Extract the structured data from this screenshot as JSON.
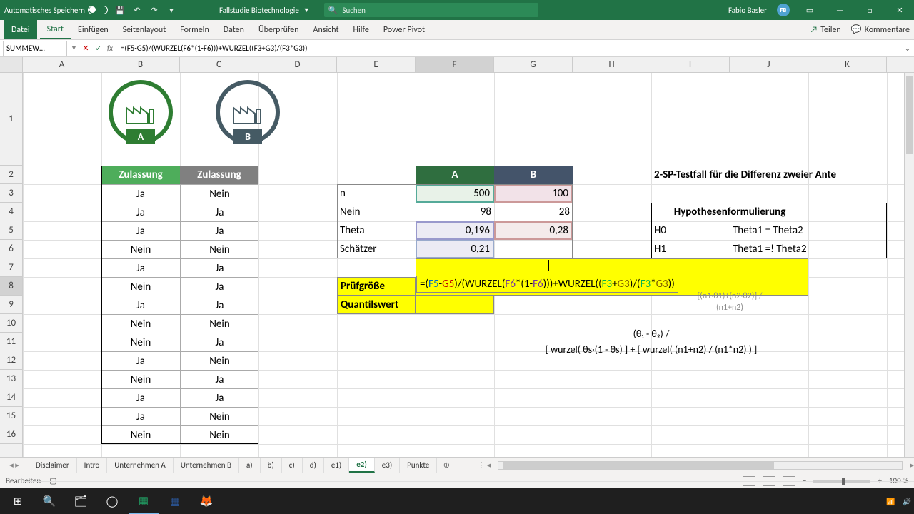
{
  "titlebar": {
    "autosave_label": "Automatisches Speichern",
    "doc_title": "Fallstudie Biotechnologie",
    "search_placeholder": "Suchen",
    "user_name": "Fabio Basler",
    "user_initials": "FB"
  },
  "ribbon": {
    "tabs": [
      "Datei",
      "Start",
      "Einfügen",
      "Seitenlayout",
      "Formeln",
      "Daten",
      "Überprüfen",
      "Ansicht",
      "Hilfe",
      "Power Pivot"
    ],
    "share": "Teilen",
    "comments": "Kommentare"
  },
  "formula_bar": {
    "namebox": "SUMMEW…",
    "formula": "=(F5-G5)/(WURZEL(F6*(1-F6)))+WURZEL((F3+G3)/(F3*G3))"
  },
  "columns": [
    "A",
    "B",
    "C",
    "D",
    "E",
    "F",
    "G",
    "H",
    "I",
    "J",
    "K"
  ],
  "rows": [
    "1",
    "2",
    "3",
    "4",
    "5",
    "6",
    "7",
    "8",
    "9",
    "10",
    "11",
    "12",
    "13",
    "14",
    "15",
    "16"
  ],
  "logo": {
    "a": "A",
    "b": "B"
  },
  "data": {
    "zul_header": "Zulassung",
    "col_b": [
      "Ja",
      "Ja",
      "Ja",
      "Nein",
      "Ja",
      "Nein",
      "Ja",
      "Nein",
      "Nein",
      "Ja",
      "Nein",
      "Ja",
      "Ja",
      "Nein"
    ],
    "col_c": [
      "Nein",
      "Ja",
      "Ja",
      "Nein",
      "Ja",
      "Ja",
      "Ja",
      "Nein",
      "Ja",
      "Nein",
      "Ja",
      "Ja",
      "Nein",
      "Nein"
    ],
    "stat_labels": {
      "n": "n",
      "nein": "Nein",
      "theta": "Theta",
      "sch": "Schätzer"
    },
    "a_header": "A",
    "b_header": "B",
    "n_a": "500",
    "n_b": "100",
    "nein_a": "98",
    "nein_b": "28",
    "theta_a": "0,196",
    "theta_b": "0,28",
    "sch_a": "0,21",
    "pruef": "Prüfgröße",
    "quant": "Quantilswert",
    "sp_title": "2-SP-Testfall für die Differenz zweier Ante",
    "hyp_title": "Hypothesenformulierung",
    "h0": "H0",
    "h0_val": "Theta1 = Theta2",
    "h1": "H1",
    "h1_val": "Theta1 =! Theta2",
    "formula_hint1": "[(n1·θ1)+(n2·θ2)] /",
    "formula_hint2": "(n1+n2)",
    "formula_hint3": "(θ₁ - θ₂) /",
    "formula_hint4": "[ wurzel( θs·(1 - θs) ] + [ wurzel( (n1+n2) / (n1*n2) ) ]"
  },
  "editing_formula": {
    "p1": "=(",
    "f5": "F5",
    "m1": "-",
    "g5": "G5",
    "p2": ")/(WURZEL(",
    "f6a": "F6",
    "m2": "*(1-",
    "f6b": "F6",
    "p3": ")))+WURZEL((",
    "f3a": "F3",
    "m3": "+",
    "g3a": "G3",
    "p4": ")/(",
    "f3b": "F3",
    "m4": "*",
    "g3b": "G3",
    "p5": "))"
  },
  "sheets": [
    "Disclaimer",
    "Intro",
    "Unternehmen A",
    "Unternehmen B",
    "a)",
    "b)",
    "c)",
    "d)",
    "e1)",
    "e2)",
    "e3)",
    "Punkte"
  ],
  "active_sheet": "e2)",
  "statusbar": {
    "mode": "Bearbeiten",
    "zoom": "100 %"
  }
}
